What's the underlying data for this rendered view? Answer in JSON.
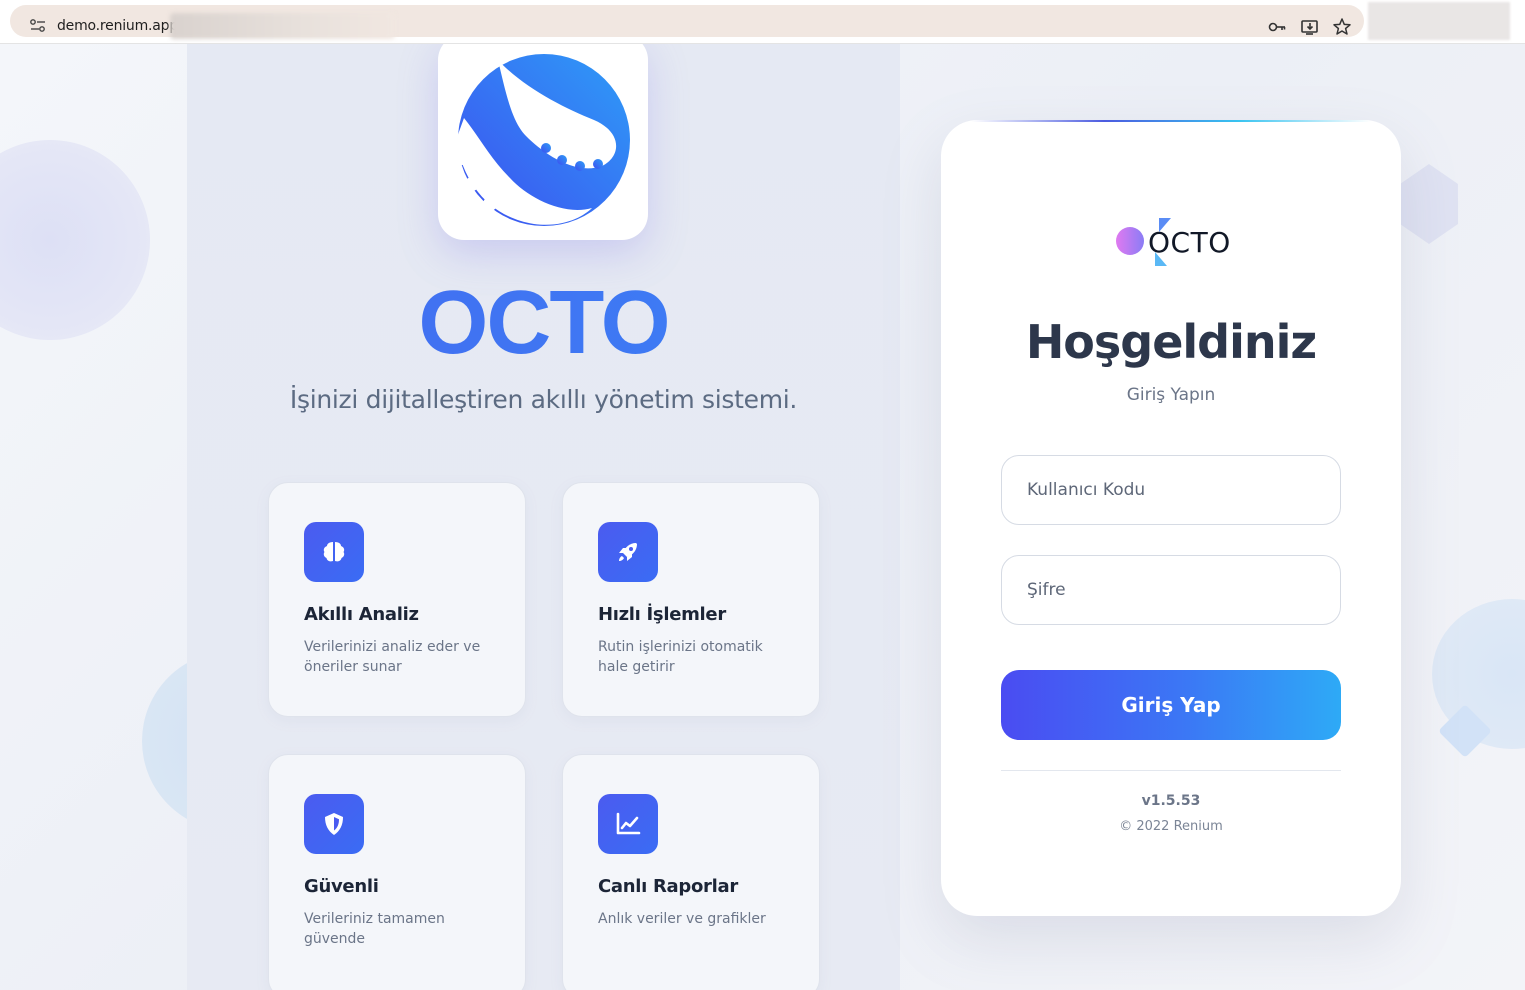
{
  "browser": {
    "url": "demo.renium.app/",
    "icons": [
      "site-info-icon",
      "key-icon",
      "install-app-icon",
      "bookmark-star-icon"
    ]
  },
  "brand": {
    "title": "OCTO",
    "tagline": "İşinizi dijitalleştiren akıllı yönetim sistemi.",
    "accent": "#3d6cf0"
  },
  "features": [
    {
      "icon": "brain-icon",
      "title": "Akıllı Analiz",
      "description": "Verilerinizi analiz eder ve öneriler sunar"
    },
    {
      "icon": "rocket-icon",
      "title": "Hızlı İşlemler",
      "description": "Rutin işlerinizi otomatik hale getirir"
    },
    {
      "icon": "shield-icon",
      "title": "Güvenli",
      "description": "Verileriniz tamamen güvende"
    },
    {
      "icon": "chart-line-icon",
      "title": "Canlı Raporlar",
      "description": "Anlık veriler ve grafikler"
    }
  ],
  "login": {
    "logo_text": "OCTO",
    "heading": "Hoşgeldiniz",
    "subtitle": "Giriş Yapın",
    "username_placeholder": "Kullanıcı Kodu",
    "password_placeholder": "Şifre",
    "submit_label": "Giriş Yap",
    "version": "v1.5.53",
    "copyright": "© 2022 Renium",
    "button_gradient": [
      "#4a4cf2",
      "#2eaaf6"
    ]
  }
}
